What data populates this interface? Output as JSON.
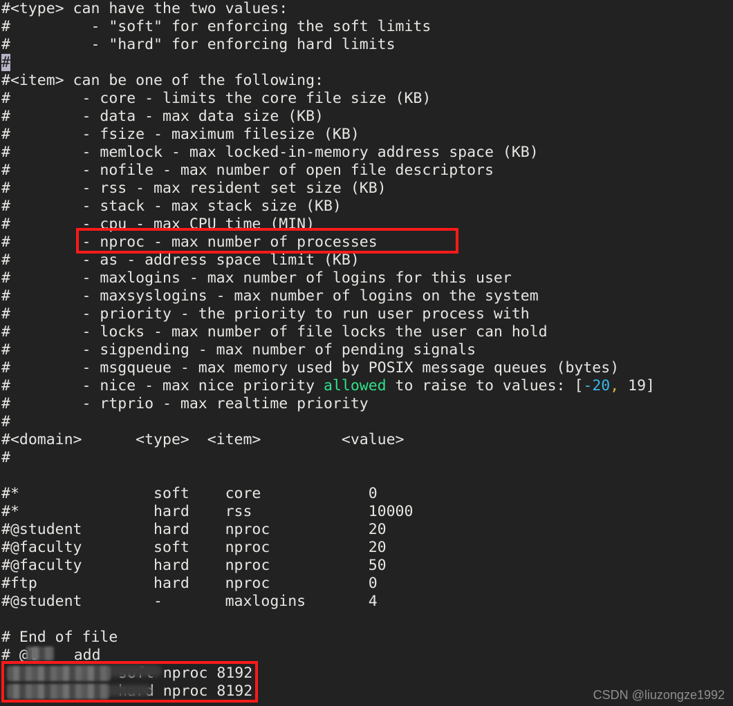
{
  "terminal": {
    "background_color": "#222222",
    "foreground_color": "#e8e6e3",
    "cursor_color": "#b5b5c6",
    "accent_green": "#2fe08a",
    "accent_cyan": "#39b8e8",
    "accent_yellow": "#d8b640",
    "highlight_color": "#ff1a1a",
    "file_lines": [
      "#<type> can have the two values:",
      "#         - \"soft\" for enforcing the soft limits",
      "#         - \"hard\" for enforcing hard limits",
      "#",
      "#<item> can be one of the following:",
      "#        - core - limits the core file size (KB)",
      "#        - data - max data size (KB)",
      "#        - fsize - maximum filesize (KB)",
      "#        - memlock - max locked-in-memory address space (KB)",
      "#        - nofile - max number of open file descriptors",
      "#        - rss - max resident set size (KB)",
      "#        - stack - max stack size (KB)",
      "#        - cpu - max CPU time (MIN)",
      "#        - nproc - max number of processes",
      "#        - as - address space limit (KB)",
      "#        - maxlogins - max number of logins for this user",
      "#        - maxsyslogins - max number of logins on the system",
      "#        - priority - the priority to run user process with",
      "#        - locks - max number of file locks the user can hold",
      "#        - sigpending - max number of pending signals",
      "#        - msgqueue - max memory used by POSIX message queues (bytes)",
      "#        - nice - max nice priority allowed to raise to values: [-20, 19]",
      "#        - rtprio - max realtime priority",
      "#",
      "#<domain>      <type>  <item>         <value>",
      "#",
      "",
      "#*               soft    core            0",
      "#*               hard    rss             10000",
      "#@student        hard    nproc           20",
      "#@faculty        soft    nproc           20",
      "#@faculty        hard    nproc           50",
      "#ftp             hard    nproc           0",
      "#@student        -       maxlogins       4",
      "",
      "# End of file",
      "# @l    add",
      "        soft nproc 8192",
      "        hard nproc 8192"
    ],
    "nice_line": {
      "prefix": "#        - nice - max nice priority ",
      "keyword": "allowed",
      "middle": " to raise to values: ",
      "bracket_open": "[",
      "low": "-20",
      "comma": ",",
      "space": " ",
      "high": "19",
      "bracket_close": "]"
    },
    "cursor_line_text": "#",
    "redacted_line_suffix_soft": "soft nproc 8192",
    "redacted_line_suffix_hard": "hard nproc 8192",
    "end_of_file_comment": "# End of file",
    "add_comment_prefix": "# @l",
    "add_comment_suffix": " add"
  },
  "annotations": {
    "highlight_nproc_label": "nproc-description-highlight",
    "highlight_bottom_label": "added-limits-highlight"
  },
  "watermark": {
    "text": "CSDN @liuzongze1992"
  }
}
